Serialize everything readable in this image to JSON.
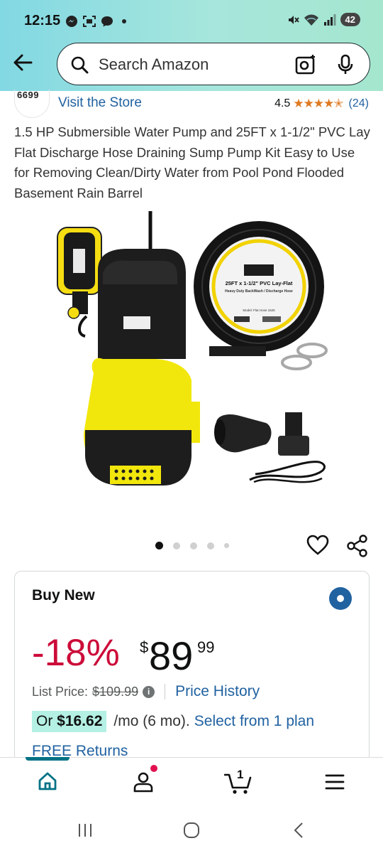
{
  "status_bar": {
    "time": "12:15",
    "battery": "42",
    "icons_left": [
      "messenger-icon",
      "scan-icon",
      "chat-icon"
    ],
    "icons_right": [
      "mute-icon",
      "wifi-icon",
      "signal-icon"
    ]
  },
  "search": {
    "placeholder": "Search Amazon"
  },
  "store": {
    "logo_text": "6699",
    "visit_label": "Visit the Store",
    "rating": "4.5",
    "stars": "★★★★✭",
    "review_count": "(24)"
  },
  "product": {
    "title": "1.5 HP Submersible Water Pump and 25FT x 1-1/2\" PVC Lay Flat Discharge Hose Draining Sump Pump Kit Easy to Use for Removing Clean/Dirty Water from Pool Pond Flooded Basement Rain Barrel",
    "pump_brand": "6699",
    "hose_label_1": "25FT x 1-1/2\" PVC Lay-Flat",
    "hose_label_2": "Heavy Duty BackWash / Discharge Hose",
    "hose_model": "Model: Flat Hose 1525"
  },
  "carousel": {
    "count": 5,
    "active": 0
  },
  "buy_box": {
    "heading": "Buy New",
    "discount": "-18%",
    "currency": "$",
    "price_whole": "89",
    "price_fraction": "99",
    "list_price_label": "List Price:",
    "list_price": "$109.99",
    "info_icon": "i",
    "price_history": "Price History",
    "monthly_prefix": "Or ",
    "monthly_amount": "$16.62",
    "monthly_term": "/mo (6 mo).",
    "plan_link": "Select from 1 plan",
    "free_word": "FREE",
    "returns_word": "Returns"
  },
  "bottom_nav": {
    "items": [
      "home-icon",
      "account-icon",
      "cart-icon",
      "menu-icon"
    ],
    "cart_count": "1"
  },
  "colors": {
    "accent_link": "#2162a1",
    "discount_red": "#cc0c39",
    "star_orange": "#de7921",
    "teal": "#007185"
  }
}
